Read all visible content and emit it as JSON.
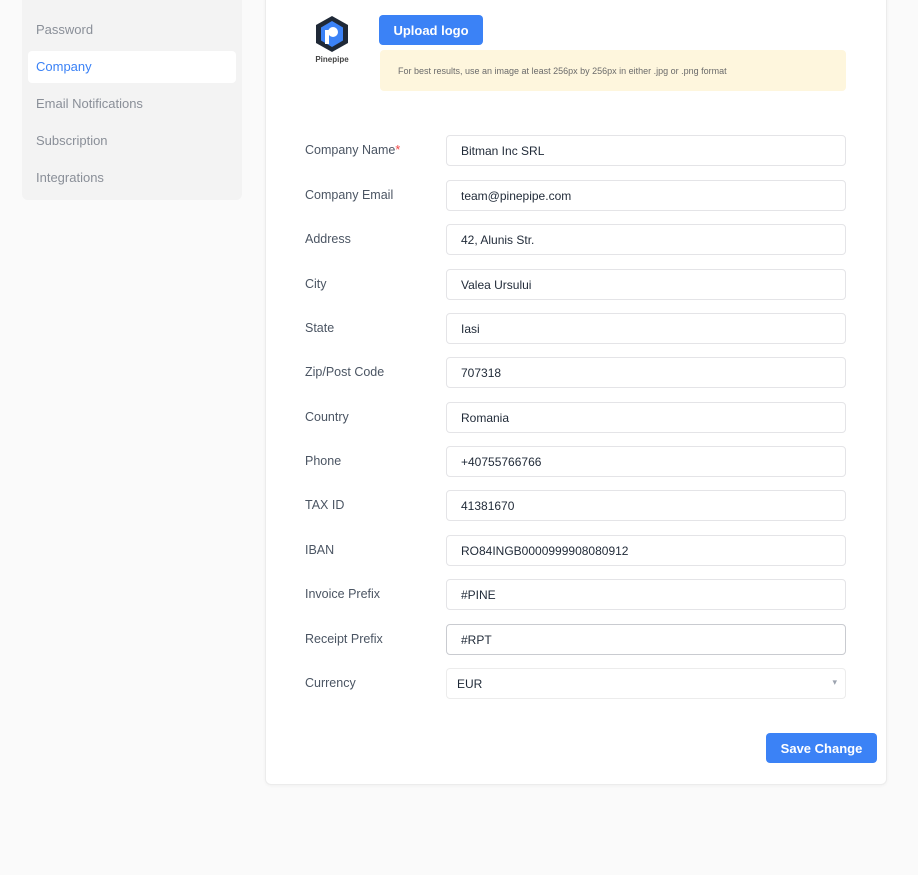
{
  "sidebar": {
    "items": [
      {
        "label": "Password",
        "active": false
      },
      {
        "label": "Company",
        "active": true
      },
      {
        "label": "Email Notifications",
        "active": false
      },
      {
        "label": "Subscription",
        "active": false
      },
      {
        "label": "Integrations",
        "active": false
      }
    ]
  },
  "logo": {
    "text": "Pinepipe",
    "color": "#3b82f6"
  },
  "upload": {
    "label": "Upload logo",
    "hint": "For best results, use an image at least 256px by 256px in either .jpg or .png format"
  },
  "form": {
    "fields": [
      {
        "label": "Company Name",
        "required": true,
        "value": "Bitman Inc SRL"
      },
      {
        "label": "Company Email",
        "required": false,
        "value": "team@pinepipe.com"
      },
      {
        "label": "Address",
        "required": false,
        "value": "42, Alunis Str."
      },
      {
        "label": "City",
        "required": false,
        "value": "Valea Ursului"
      },
      {
        "label": "State",
        "required": false,
        "value": "Iasi"
      },
      {
        "label": "Zip/Post Code",
        "required": false,
        "value": "707318"
      },
      {
        "label": "Country",
        "required": false,
        "value": "Romania"
      },
      {
        "label": "Phone",
        "required": false,
        "value": "+40755766766"
      },
      {
        "label": "TAX ID",
        "required": false,
        "value": "41381670"
      },
      {
        "label": "IBAN",
        "required": false,
        "value": "RO84INGB0000999908080912"
      },
      {
        "label": "Invoice Prefix",
        "required": false,
        "value": "#PINE"
      },
      {
        "label": "Receipt Prefix",
        "required": false,
        "value": "#RPT"
      }
    ],
    "currency": {
      "label": "Currency",
      "value": "EUR",
      "chevron": "▾"
    }
  },
  "actions": {
    "save_label": "Save Change"
  },
  "colors": {
    "accent": "#3b82f6",
    "hint_bg": "#fef6dd",
    "required": "#ef4444"
  }
}
